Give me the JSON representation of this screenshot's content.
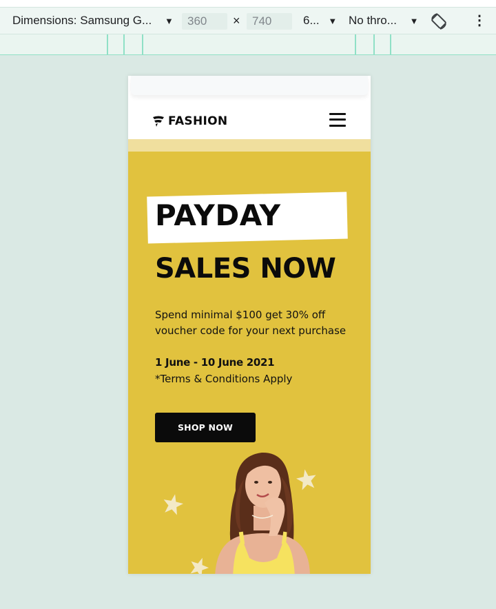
{
  "devtools": {
    "dimensions_label": "Dimensions: Samsung G...",
    "width_value": "360",
    "times_symbol": "×",
    "height_value": "740",
    "zoom_label": "6...",
    "throttle_label": "No thro...",
    "caret": "▼",
    "more_glyph": "⋮"
  },
  "site": {
    "brand": "FASHION",
    "hero": {
      "headline_line1": "PAYDAY",
      "headline_line2": "SALES NOW",
      "description": "Spend minimal $100 get 30% off voucher code for your next purchase",
      "dates": "1 June - 10 June 2021",
      "terms": "*Terms & Conditions Apply",
      "cta_label": "SHOP NOW"
    }
  },
  "colors": {
    "hero_background": "#e1c23e",
    "hero_light_band": "#f0df9e",
    "star": "#f3e9c6",
    "button": "#0b0b0b"
  }
}
